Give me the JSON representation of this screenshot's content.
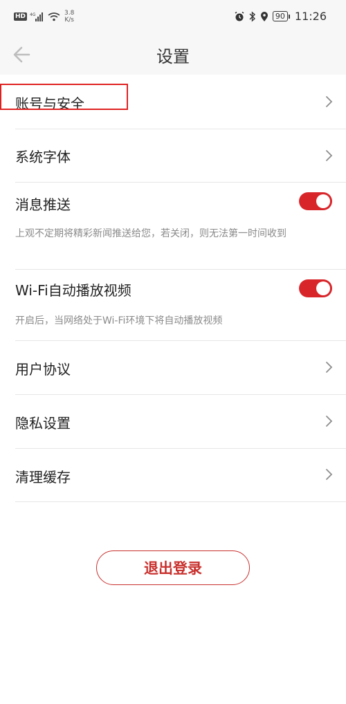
{
  "status_bar": {
    "hd": "HD",
    "net_gen": "4G",
    "net_speed_value": "3.8",
    "net_speed_unit": "K/s",
    "battery": "90",
    "time": "11:26"
  },
  "header": {
    "title": "设置"
  },
  "items": {
    "account": "账号与安全",
    "font": "系统字体",
    "push": "消息推送",
    "push_desc": "上观不定期将精彩新闻推送给您，若关闭，则无法第一时间收到",
    "wifi_video": "Wi-Fi自动播放视频",
    "wifi_video_desc": "开启后，当网络处于Wi-Fi环境下将自动播放视频",
    "agreement": "用户协议",
    "privacy": "隐私设置",
    "cache": "清理缓存"
  },
  "toggles": {
    "push_on": true,
    "wifi_video_on": true
  },
  "logout": {
    "label": "退出登录"
  },
  "colors": {
    "accent": "#d8252a",
    "logout": "#c8302d",
    "highlight": "#e02020"
  }
}
